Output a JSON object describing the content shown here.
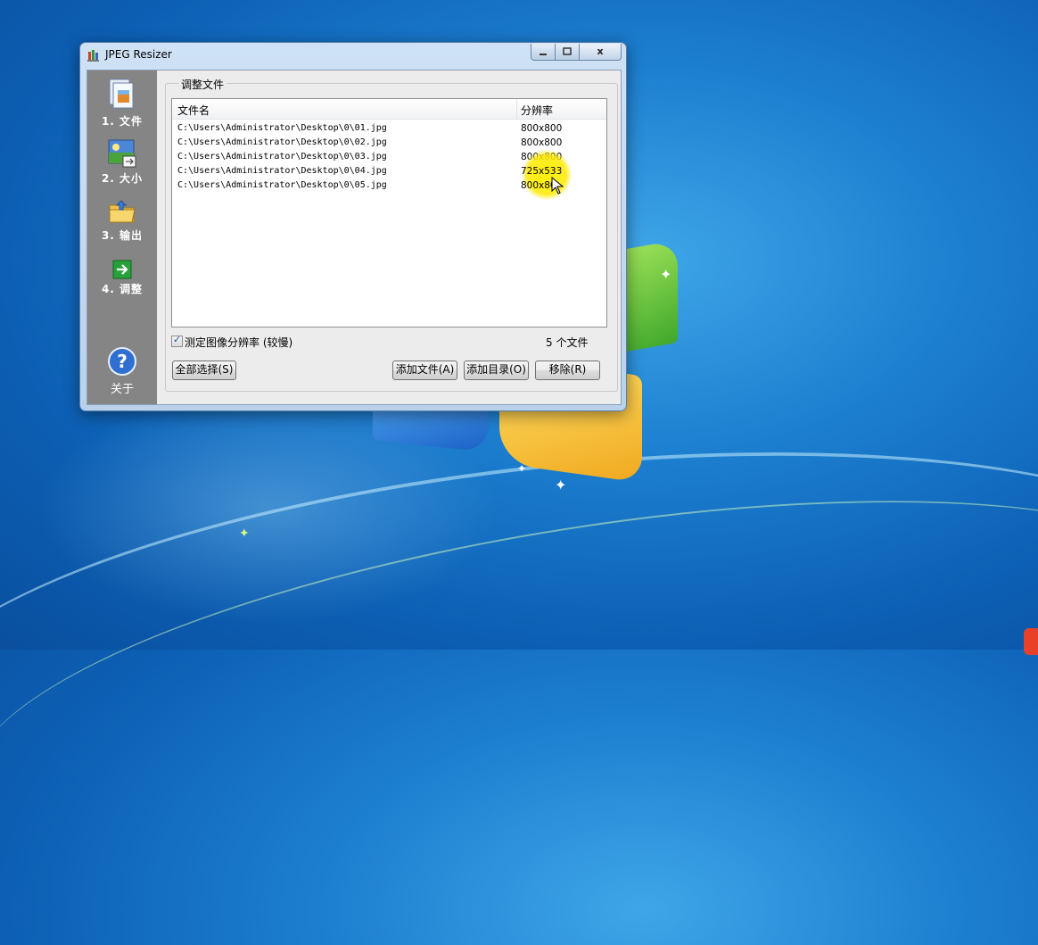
{
  "window": {
    "title": "JPEG Resizer",
    "close_glyph": "x"
  },
  "sidebar": {
    "items": [
      {
        "label": "1. 文件",
        "icon": "files-icon"
      },
      {
        "label": "2. 大小",
        "icon": "image-size-icon"
      },
      {
        "label": "3. 输出",
        "icon": "output-folder-icon"
      },
      {
        "label": "4. 调整",
        "icon": "arrow-right-icon"
      }
    ],
    "about": {
      "label": "关于",
      "icon": "help-icon"
    }
  },
  "group": {
    "title": "调整文件"
  },
  "list": {
    "columns": [
      "文件名",
      "分辨率"
    ],
    "rows": [
      {
        "name": "C:\\Users\\Administrator\\Desktop\\0\\01.jpg",
        "res": "800x800"
      },
      {
        "name": "C:\\Users\\Administrator\\Desktop\\0\\02.jpg",
        "res": "800x800"
      },
      {
        "name": "C:\\Users\\Administrator\\Desktop\\0\\03.jpg",
        "res": "800x800"
      },
      {
        "name": "C:\\Users\\Administrator\\Desktop\\0\\04.jpg",
        "res": "725x533"
      },
      {
        "name": "C:\\Users\\Administrator\\Desktop\\0\\05.jpg",
        "res": "800x80"
      }
    ]
  },
  "options": {
    "detect_resolution_label": "测定图像分辨率 (较慢)",
    "detect_resolution_checked": true,
    "file_count": "5 个文件"
  },
  "buttons": {
    "select_all": "全部选择(S)",
    "add_file": "添加文件(A)",
    "add_dir": "添加目录(O)",
    "remove": "移除(R)"
  },
  "colors": {
    "sidebar": "#858585",
    "cursor_highlight": "#ffee00",
    "desktop": "#1d7fd0"
  }
}
